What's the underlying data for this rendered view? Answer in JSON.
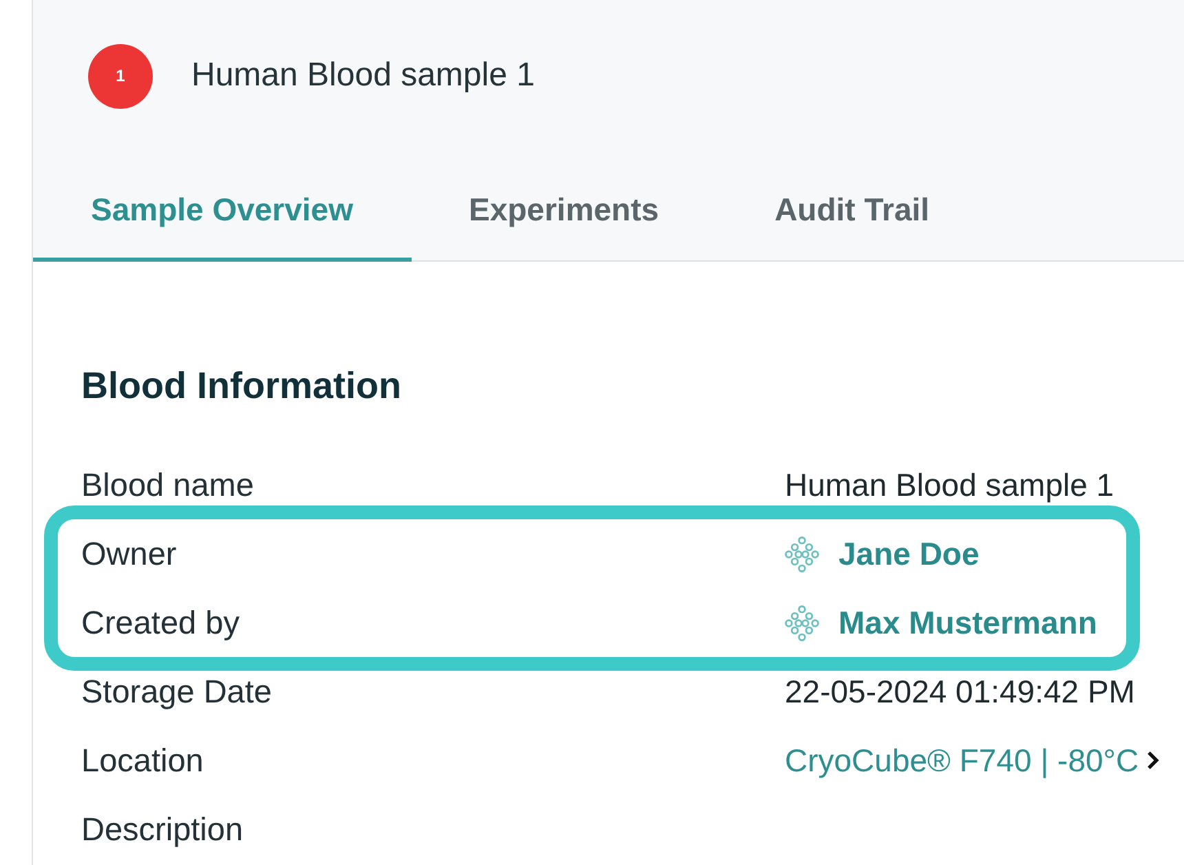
{
  "header": {
    "badge": "1",
    "title": "Human Blood sample 1"
  },
  "tabs": [
    {
      "label": "Sample Overview",
      "selected": true
    },
    {
      "label": "Experiments",
      "selected": false
    },
    {
      "label": "Audit Trail",
      "selected": false
    }
  ],
  "section": {
    "title": "Blood Information",
    "fields": [
      {
        "label": "Blood name",
        "kind": "text",
        "value": "Human Blood sample 1",
        "highlighted": false
      },
      {
        "label": "Owner",
        "kind": "user",
        "value": "Jane Doe",
        "highlighted": true
      },
      {
        "label": "Created by",
        "kind": "user",
        "value": "Max Mustermann",
        "highlighted": true
      },
      {
        "label": "Storage Date",
        "kind": "text",
        "value": "22-05-2024 01:49:42 PM",
        "highlighted": false
      },
      {
        "label": "Location",
        "kind": "link",
        "value": "CryoCube® F740 | -80°C",
        "highlighted": false
      },
      {
        "label": "Description",
        "kind": "text",
        "highlighted": false
      }
    ]
  }
}
